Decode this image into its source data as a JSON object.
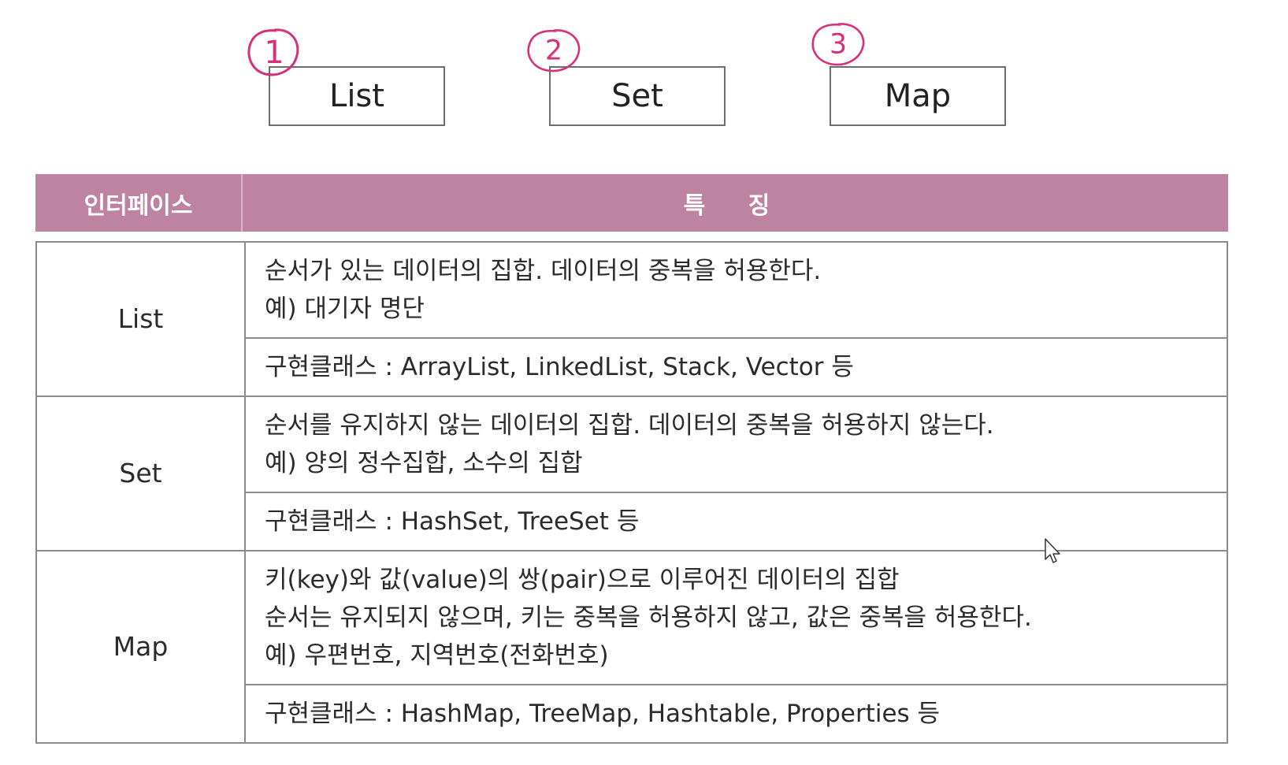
{
  "interfaces": [
    {
      "number": "1",
      "label": "List"
    },
    {
      "number": "2",
      "label": "Set"
    },
    {
      "number": "3",
      "label": "Map"
    }
  ],
  "table": {
    "header": {
      "interface": "인터페이스",
      "features": "특 징"
    },
    "rows": [
      {
        "name": "List",
        "description": [
          "순서가 있는 데이터의 집합. 데이터의 중복을 허용한다.",
          "예) 대기자 명단"
        ],
        "classes": "구현클래스 : ArrayList, LinkedList, Stack, Vector 등"
      },
      {
        "name": "Set",
        "description": [
          "순서를 유지하지 않는 데이터의 집합. 데이터의 중복을 허용하지 않는다.",
          "예) 양의 정수집합, 소수의 집합"
        ],
        "classes": "구현클래스 : HashSet, TreeSet 등"
      },
      {
        "name": "Map",
        "description": [
          "키(key)와 값(value)의 쌍(pair)으로 이루어진 데이터의 집합",
          "순서는 유지되지 않으며, 키는 중복을 허용하지 않고, 값은 중복을 허용한다.",
          "예) 우편번호, 지역번호(전화번호)"
        ],
        "classes": "구현클래스 : HashMap, TreeMap, Hashtable, Properties 등"
      }
    ]
  },
  "colors": {
    "header_bg": "#bd83a1",
    "annotation": "#d6307a"
  },
  "icons": {
    "pointer": "mouse-pointer-icon"
  }
}
